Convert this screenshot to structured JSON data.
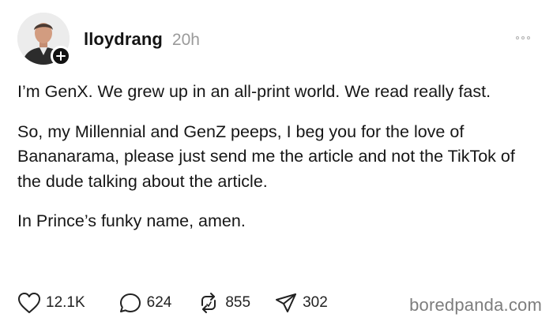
{
  "post": {
    "username": "lloydrang",
    "time": "20h",
    "paragraphs": [
      "I’m GenX. We grew up in an all-print world. We read really fast.",
      "So, my Millennial and GenZ peeps, I beg you for the love of Bananarama, please just send me the article and not the TikTok of the dude talking about the article.",
      "In Prince’s funky name, amen."
    ]
  },
  "actions": {
    "likes": "12.1K",
    "replies": "624",
    "reposts": "855",
    "shares": "302"
  },
  "watermark": "boredpanda.com",
  "icons": {
    "like": "heart-icon",
    "reply": "speech-bubble-icon",
    "repost": "repost-arrows-icon",
    "share": "send-icon",
    "more": "more-dots-icon",
    "follow": "plus-icon"
  }
}
